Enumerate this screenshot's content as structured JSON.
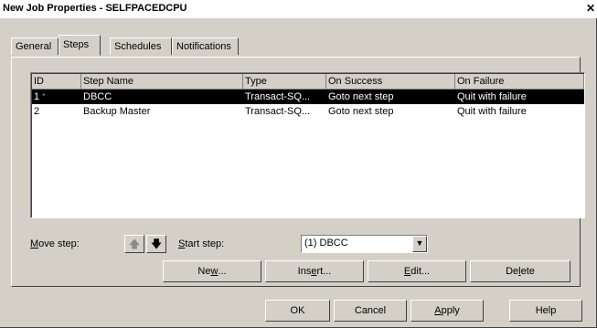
{
  "window": {
    "title": "New Job Properties - SELFPACEDCPU",
    "close_glyph": "✕"
  },
  "tabs": [
    {
      "label": "General"
    },
    {
      "label": "Steps",
      "active": true
    },
    {
      "label": "Schedules"
    },
    {
      "label": "Notifications"
    }
  ],
  "steps_list": {
    "columns": [
      "ID",
      "Step Name",
      "Type",
      "On Success",
      "On Failure"
    ],
    "rows": [
      {
        "id": "1",
        "marker": "*",
        "name": "DBCC",
        "type": "Transact-SQ...",
        "on_success": "Goto next step",
        "on_failure": "Quit with failure",
        "selected": true
      },
      {
        "id": "2",
        "marker": "",
        "name": "Backup Master",
        "type": "Transact-SQ...",
        "on_success": "Goto next step",
        "on_failure": "Quit with failure",
        "selected": false
      }
    ]
  },
  "move_step": {
    "label_accel": "M",
    "label_rest": "ove step:",
    "up_icon": "up-arrow-icon",
    "down_icon": "down-arrow-icon",
    "up_glyph": "🡅",
    "down_glyph": "🡇"
  },
  "start_step": {
    "label_accel": "S",
    "label_rest": "tart step:",
    "value": "(1) DBCC"
  },
  "step_buttons": {
    "new_pre": "Ne",
    "new_accel": "w",
    "new_post": "...",
    "insert_pre": "Ins",
    "insert_accel": "e",
    "insert_post": "rt...",
    "edit_pre": "",
    "edit_accel": "E",
    "edit_post": "dit...",
    "delete_pre": "De",
    "delete_accel": "l",
    "delete_post": "ete"
  },
  "dialog_buttons": {
    "ok": "OK",
    "cancel": "Cancel",
    "apply_accel": "A",
    "apply_rest": "pply",
    "help": "Help"
  }
}
